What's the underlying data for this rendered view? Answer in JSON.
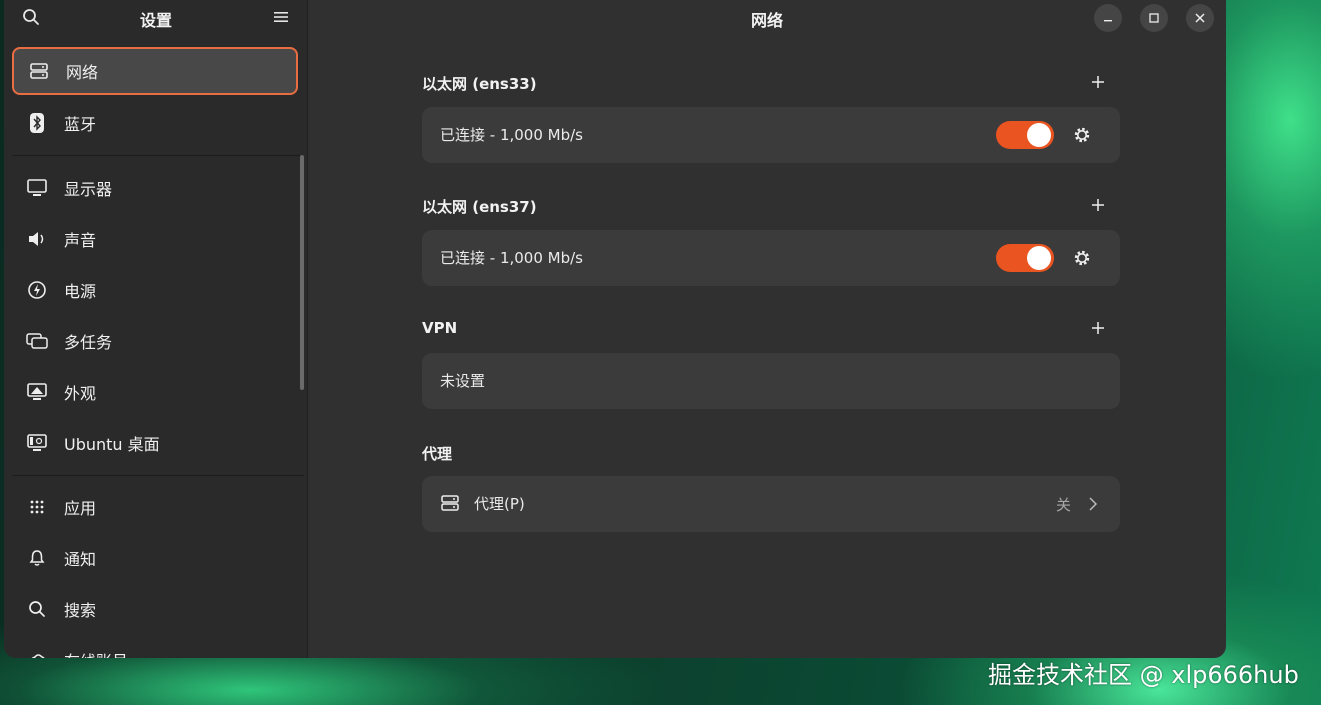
{
  "sidebar": {
    "title": "设置",
    "items": [
      {
        "label": "网络",
        "icon": "network-icon"
      },
      {
        "label": "蓝牙",
        "icon": "bluetooth-icon"
      },
      {
        "label": "显示器",
        "icon": "display-icon"
      },
      {
        "label": "声音",
        "icon": "sound-icon"
      },
      {
        "label": "电源",
        "icon": "power-icon"
      },
      {
        "label": "多任务",
        "icon": "multitasking-icon"
      },
      {
        "label": "外观",
        "icon": "appearance-icon"
      },
      {
        "label": "Ubuntu 桌面",
        "icon": "ubuntu-desktop-icon"
      },
      {
        "label": "应用",
        "icon": "apps-icon"
      },
      {
        "label": "通知",
        "icon": "bell-icon"
      },
      {
        "label": "搜索",
        "icon": "search-icon"
      },
      {
        "label": "在线账号",
        "icon": "online-accounts-icon"
      }
    ],
    "active_index": 0
  },
  "main": {
    "title": "网络",
    "sections": [
      {
        "title": "以太网 (ens33)",
        "status": "已连接 - 1,000 Mb/s",
        "toggle_on": true
      },
      {
        "title": "以太网 (ens37)",
        "status": "已连接 - 1,000 Mb/s",
        "toggle_on": true
      },
      {
        "title": "VPN",
        "status": "未设置"
      },
      {
        "title": "代理",
        "row_label": "代理(P)",
        "row_value": "关"
      }
    ]
  },
  "colors": {
    "accent": "#e95420",
    "active_border": "#e96d43",
    "window_bg": "#303030",
    "sidebar_bg": "#2a2a2a",
    "card_bg": "#3b3b3b"
  },
  "watermark": "掘金技术社区 @ xlp666hub"
}
